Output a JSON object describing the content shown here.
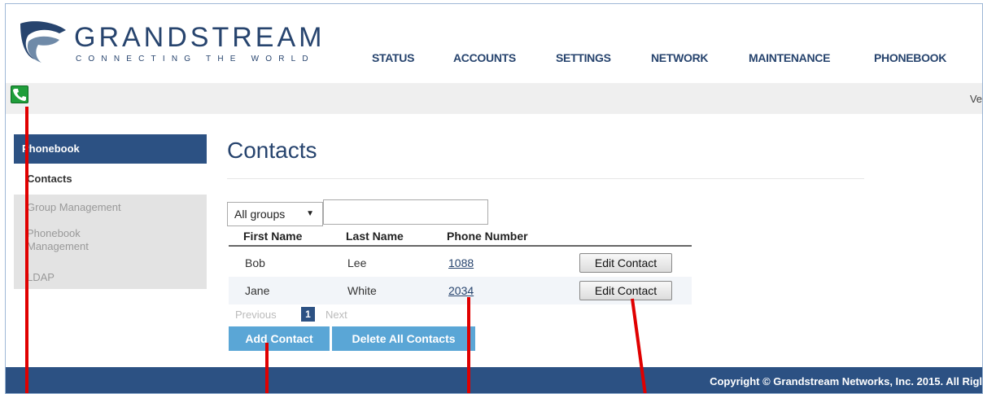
{
  "header": {
    "brand": "GRANDSTREAM",
    "tagline": "CONNECTING THE WORLD",
    "nav": [
      "STATUS",
      "ACCOUNTS",
      "SETTINGS",
      "NETWORK",
      "MAINTENANCE",
      "PHONEBOOK"
    ]
  },
  "statusbar": {
    "version_text": "Ve"
  },
  "sidebar": {
    "section": "Phonebook",
    "items": [
      {
        "label": "Contacts",
        "active": true
      },
      {
        "label": "Group Management",
        "active": false
      },
      {
        "label": "Phonebook Management",
        "active": false
      },
      {
        "label": "LDAP",
        "active": false
      }
    ]
  },
  "main": {
    "title": "Contacts",
    "filter": {
      "selected": "All groups",
      "search_value": ""
    },
    "columns": [
      "First Name",
      "Last Name",
      "Phone Number"
    ],
    "rows": [
      {
        "first": "Bob",
        "last": "Lee",
        "phone": "1088",
        "action": "Edit Contact"
      },
      {
        "first": "Jane",
        "last": "White",
        "phone": "2034",
        "action": "Edit Contact"
      }
    ],
    "pager": {
      "previous": "Previous",
      "current": "1",
      "next": "Next"
    },
    "add_button": "Add Contact",
    "delete_button": "Delete All Contacts"
  },
  "footer": {
    "copyright": "Copyright © Grandstream Networks, Inc. 2015. All Rigl"
  },
  "colors": {
    "brand": "#27446e",
    "sidebar_header": "#2c5183",
    "action_button": "#5aa6d6",
    "annotation": "#e00000"
  }
}
